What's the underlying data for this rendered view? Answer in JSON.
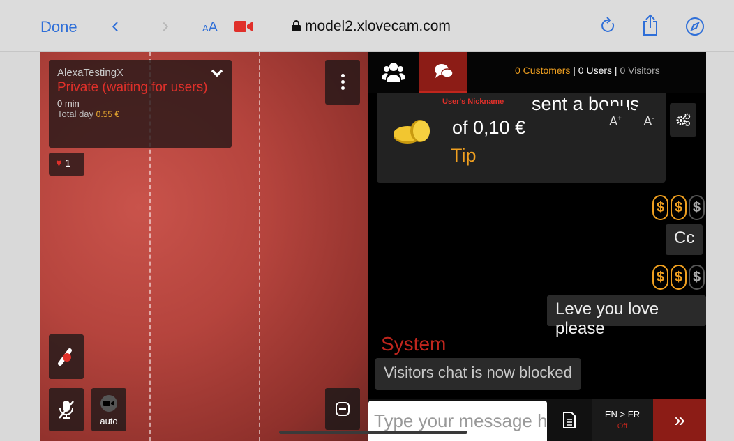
{
  "browser": {
    "done_label": "Done",
    "text_size_label": "AA",
    "url": "model2.xlovecam.com"
  },
  "model": {
    "name": "AlexaTestingX",
    "status": "Private (waiting for users)",
    "minutes": "0 min",
    "total_day_label": "Total day",
    "total_day_value": "0.55 €",
    "likes": "1"
  },
  "video": {
    "camera_mode": "auto"
  },
  "chat": {
    "counts": {
      "customers": "0 Customers",
      "users": "0 Users",
      "visitors": "0 Visitors",
      "separator": "|"
    },
    "tip": {
      "nickname": "User's Nickname",
      "sent": "sent a bonus",
      "amount": "of 0,10 €",
      "word": "Tip"
    },
    "font_increase": "A",
    "font_decrease": "A",
    "font_increase_sup": "+",
    "font_decrease_sup": "-",
    "messages": [
      {
        "text": "Cc",
        "rating": 2
      },
      {
        "text": "Leve you love please",
        "rating": 2
      }
    ],
    "dollar_symbol": "$",
    "system_label": "System",
    "system_message": "Visitors chat is now blocked",
    "input_placeholder": "Type your message here",
    "lang_pair": "EN > FR",
    "lang_status": "Off",
    "send_label": "»"
  },
  "colors": {
    "accent_red": "#c0261d",
    "tab_red": "#8c1c16",
    "gold": "#f0a020",
    "safari_blue": "#2f6fd8"
  }
}
